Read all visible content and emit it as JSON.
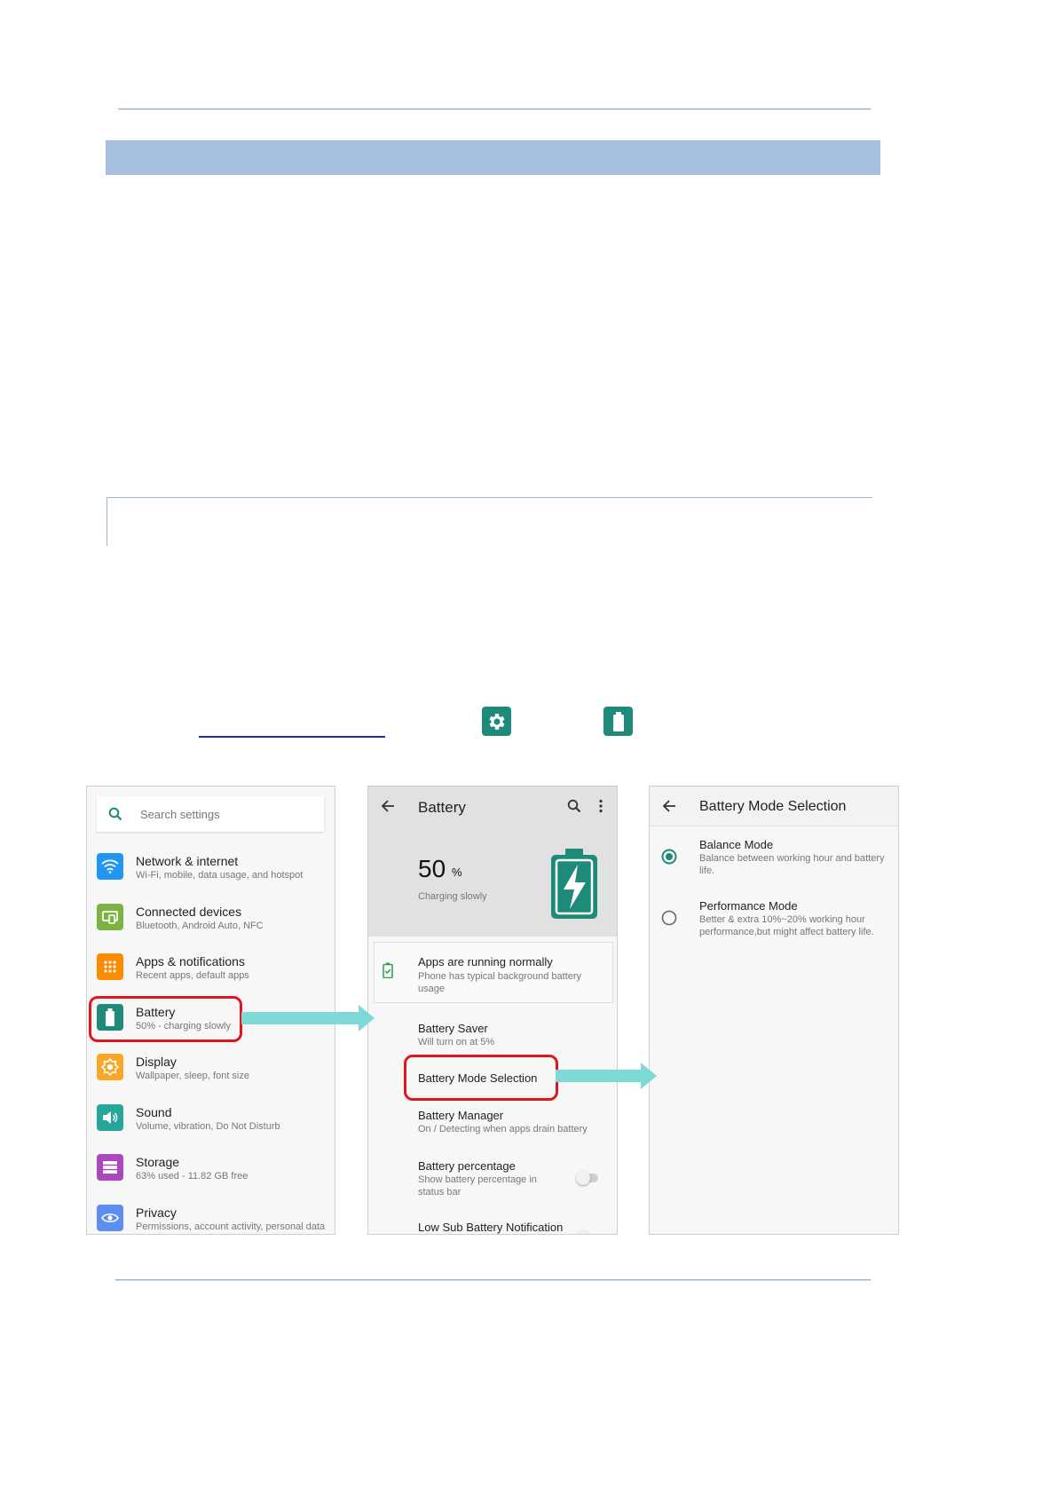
{
  "settings_screen": {
    "search_placeholder": "Search settings",
    "items": [
      {
        "title": "Network & internet",
        "sub": "Wi-Fi, mobile, data usage, and hotspot",
        "icon": "wifi-icon",
        "color": "#2196f3"
      },
      {
        "title": "Connected devices",
        "sub": "Bluetooth, Android Auto, NFC",
        "icon": "connected-devices-icon",
        "color": "#7cb342"
      },
      {
        "title": "Apps & notifications",
        "sub": "Recent apps, default apps",
        "icon": "apps-grid-icon",
        "color": "#fb8c00"
      },
      {
        "title": "Battery",
        "sub": "50% - charging slowly",
        "icon": "battery-icon",
        "color": "#1e8a7a"
      },
      {
        "title": "Display",
        "sub": "Wallpaper, sleep, font size",
        "icon": "display-brightness-icon",
        "color": "#f9a825"
      },
      {
        "title": "Sound",
        "sub": "Volume, vibration, Do Not Disturb",
        "icon": "sound-icon",
        "color": "#26a69a"
      },
      {
        "title": "Storage",
        "sub": "63% used - 11.82 GB free",
        "icon": "storage-icon",
        "color": "#ab47bc"
      },
      {
        "title": "Privacy",
        "sub": "Permissions, account activity, personal data",
        "icon": "privacy-eye-icon",
        "color": "#5c8df2"
      }
    ]
  },
  "battery_screen": {
    "title": "Battery",
    "level_value": "50",
    "level_unit": "%",
    "status": "Charging slowly",
    "apps_card": {
      "title": "Apps are running normally",
      "sub": "Phone has typical background battery usage"
    },
    "items": [
      {
        "title": "Battery Saver",
        "sub": "Will turn on at 5%"
      },
      {
        "title": "Battery Mode Selection",
        "sub": ""
      },
      {
        "title": "Battery Manager",
        "sub": "On / Detecting when apps drain battery"
      },
      {
        "title": "Battery percentage",
        "sub": "Show battery percentage in status bar"
      },
      {
        "title": "Low Sub Battery Notification",
        "sub": ""
      }
    ]
  },
  "mode_screen": {
    "title": "Battery Mode Selection",
    "options": [
      {
        "title": "Balance Mode",
        "sub": "Balance between working hour and battery life.",
        "selected": true
      },
      {
        "title": "Performance Mode",
        "sub": "Better & extra 10%~20% working hour performance,but might affect battery life.",
        "selected": false
      }
    ]
  },
  "colors": {
    "accent": "#1e8a7a",
    "highlight": "#e0161e",
    "arrow": "#7fd9d6",
    "header_band": "#a6bfdf"
  }
}
